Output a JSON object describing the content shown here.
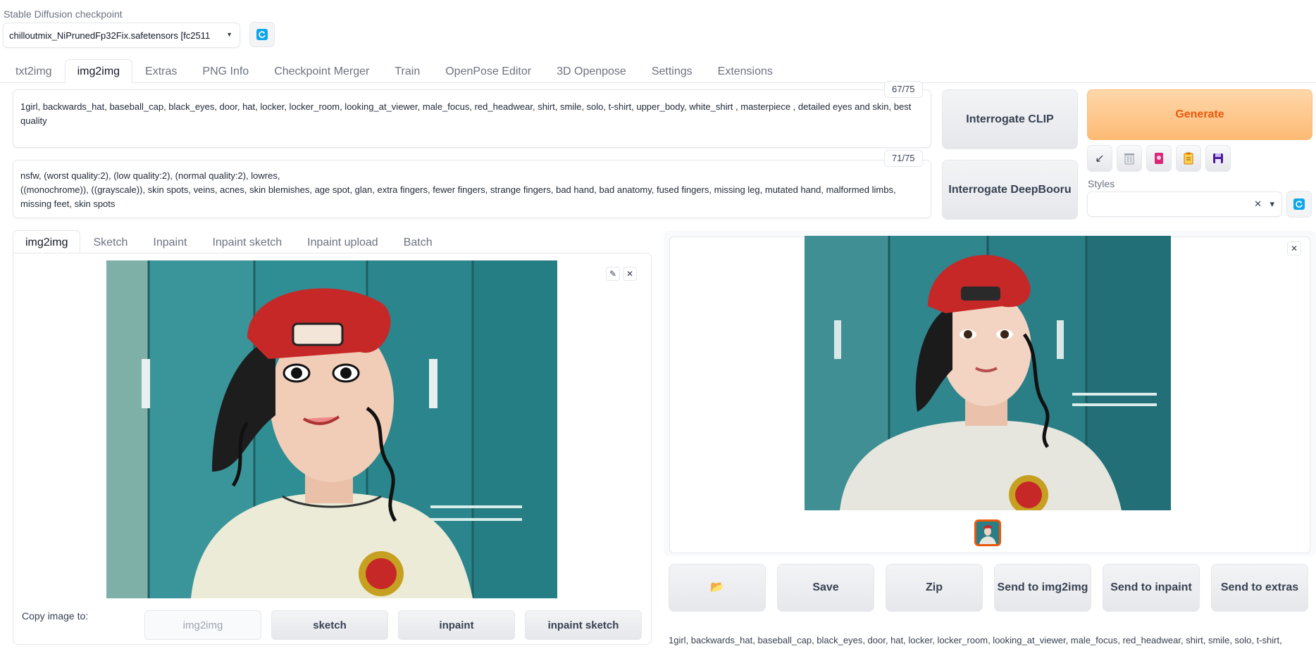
{
  "checkpoint": {
    "label": "Stable Diffusion checkpoint",
    "value": "chilloutmix_NiPrunedFp32Fix.safetensors [fc2511",
    "caret_icon": "chevron-down-icon",
    "refresh_icon": "refresh-icon"
  },
  "tabs": [
    {
      "label": "txt2img"
    },
    {
      "label": "img2img",
      "active": true
    },
    {
      "label": "Extras"
    },
    {
      "label": "PNG Info"
    },
    {
      "label": "Checkpoint Merger"
    },
    {
      "label": "Train"
    },
    {
      "label": "OpenPose Editor"
    },
    {
      "label": "3D Openpose"
    },
    {
      "label": "Settings"
    },
    {
      "label": "Extensions"
    }
  ],
  "prompt": {
    "text": "1girl, backwards_hat, baseball_cap, black_eyes, door, hat, locker, locker_room, looking_at_viewer, male_focus, red_headwear, shirt, smile, solo, t-shirt, upper_body, white_shirt , masterpiece , detailed eyes and skin, best quality",
    "counter": "67/75"
  },
  "negative_prompt": {
    "line1": "nsfw, (worst quality:2), (low quality:2), (normal quality:2), lowres,",
    "line2": "((monochrome)), ((grayscale)), skin spots, veins, acnes, skin blemishes, age spot, glan, extra fingers, fewer fingers, strange fingers, bad hand, bad anatomy, fused fingers, missing leg, mutated hand, malformed limbs,",
    "line3": "missing feet, skin spots",
    "counter": "71/75"
  },
  "buttons": {
    "interrogate_clip": "Interrogate CLIP",
    "interrogate_deepbooru": "Interrogate DeepBooru",
    "generate": "Generate"
  },
  "tools": [
    {
      "icon": "arrow-down-left-icon",
      "glyph": "↙"
    },
    {
      "icon": "trash-icon",
      "glyph": "🗑"
    },
    {
      "icon": "card-icon",
      "glyph": "🎴"
    },
    {
      "icon": "clipboard-icon",
      "glyph": "📋"
    },
    {
      "icon": "save-icon",
      "glyph": "💾"
    }
  ],
  "styles": {
    "label": "Styles",
    "value": "",
    "clear_glyph": "✕",
    "caret_glyph": "▾"
  },
  "input_tabs": [
    {
      "label": "img2img",
      "active": true
    },
    {
      "label": "Sketch"
    },
    {
      "label": "Inpaint"
    },
    {
      "label": "Inpaint sketch"
    },
    {
      "label": "Inpaint upload"
    },
    {
      "label": "Batch"
    }
  ],
  "copy": {
    "label": "Copy image to:",
    "buttons": [
      {
        "label": "img2img",
        "disabled": true
      },
      {
        "label": "sketch"
      },
      {
        "label": "inpaint"
      },
      {
        "label": "inpaint sketch"
      }
    ]
  },
  "output_buttons": {
    "folder_glyph": "📂",
    "save": "Save",
    "zip": "Zip",
    "send_img2img": "Send to img2img",
    "send_inpaint": "Send to inpaint",
    "send_extras": "Send to extras"
  },
  "output_info": "1girl, backwards_hat, baseball_cap, black_eyes, door, hat, locker, locker_room, looking_at_viewer, male_focus, red_headwear, shirt, smile, solo, t-shirt,",
  "colors": {
    "accent": "#ea580c",
    "generate_bg": "#fdba74",
    "refresh": "#0ea5e9",
    "locker": "#2e8a8f",
    "cap": "#c62828"
  }
}
